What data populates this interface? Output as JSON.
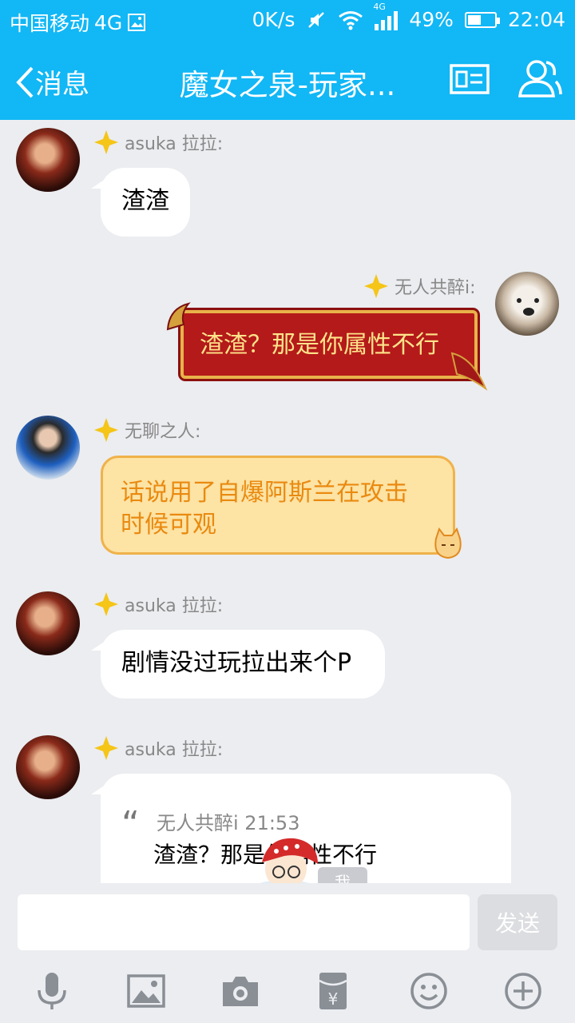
{
  "status_bar": {
    "carrier": "中国移动",
    "network": "4G",
    "speed": "0K/s",
    "signal_badge": "4G",
    "battery_percent": "49%",
    "battery_level": 0.49,
    "time": "22:04"
  },
  "nav": {
    "back_label": "消息",
    "title": "魔女之泉-玩家...",
    "icons": [
      "profile-card-icon",
      "group-members-icon"
    ]
  },
  "messages": [
    {
      "sender": "asuka 拉拉:",
      "text": "渣渣"
    },
    {
      "sender": "无人共醉i:",
      "text": "渣渣？那是你属性不行"
    },
    {
      "sender": "无聊之人:",
      "line1": "话说用了自爆阿斯兰在攻击",
      "line2": "时候可观"
    },
    {
      "sender": "asuka 拉拉:",
      "text": "剧情没过玩拉出来个P"
    },
    {
      "sender": "asuka 拉拉:",
      "quote_name": "无人共醉i 21:53",
      "quote_text": "渣渣？那是你属性不行"
    }
  ],
  "overlay": {
    "me_label": "我"
  },
  "input": {
    "send_label": "发送",
    "value": ""
  },
  "toolbar": [
    "microphone-icon",
    "image-icon",
    "camera-icon",
    "red-packet-icon",
    "emoji-icon",
    "plus-icon"
  ],
  "colors": {
    "header": "#12b7f5",
    "background": "#ebedf0",
    "bubble": "#ffffff",
    "gold_text": "#e98a10",
    "red_bubble": "#b41a1a"
  }
}
